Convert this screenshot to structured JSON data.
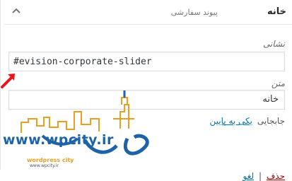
{
  "menu_item": {
    "title": "خانه",
    "type": "پیوند سفارشی",
    "url_label": "نشانی",
    "url_value": "#evision-corporate-slider",
    "text_label": "متن",
    "text_value": "خانه",
    "move_label": "جابجایی",
    "move_link": "یکی به پایین",
    "remove_label": "حذف",
    "separator": "|",
    "cancel_label": "لغو"
  },
  "watermark": {
    "url": "www.wpcity.ir",
    "site_name": "wordpress city",
    "site_url": "www.wpcity.ir"
  },
  "colors": {
    "accent_link": "#0073aa",
    "remove": "#aa0000",
    "annotation_arrow": "#e8161b",
    "watermark_blue": "#1e63a6",
    "watermark_orange": "#e9a020"
  }
}
